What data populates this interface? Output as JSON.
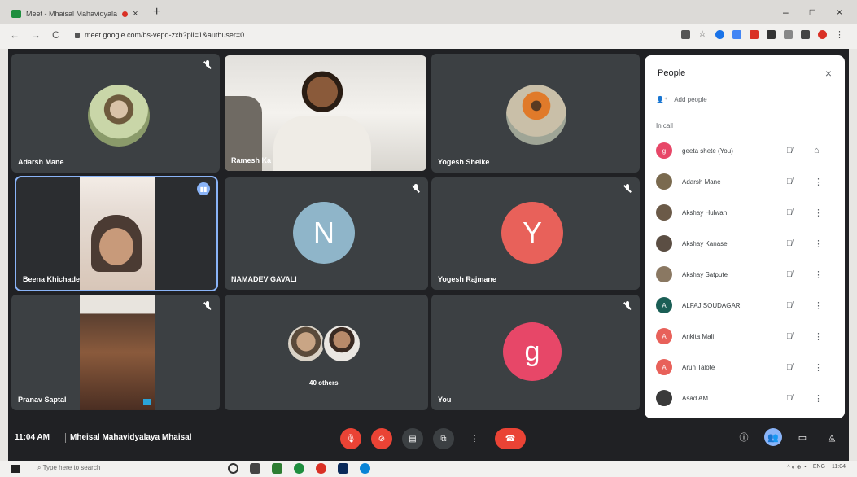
{
  "browser": {
    "tab_title": "Meet - Mhaisal Mahavidyala",
    "tab_close": "×",
    "new_tab": "+",
    "url": "meet.google.com/bs-vepd-zxb?pli=1&authuser=0",
    "win_min": "–",
    "win_max": "□",
    "win_close": "×"
  },
  "tiles": [
    {
      "name": "Adarsh Mane",
      "type": "photo",
      "muted": true
    },
    {
      "name": "Ramesh Ka",
      "type": "video",
      "muted": false
    },
    {
      "name": "Yogesh Shelke",
      "type": "photo",
      "muted": false
    },
    {
      "name": "Beena Khichade",
      "type": "video",
      "muted": false,
      "selected": true
    },
    {
      "name": "NAMADEV GAVALI",
      "type": "letter",
      "letter": "N",
      "color": "#8fb5c9",
      "muted": true
    },
    {
      "name": "Yogesh Rajmane",
      "type": "letter",
      "letter": "Y",
      "color": "#e8615a",
      "muted": true
    },
    {
      "name": "Pranav Saptal",
      "type": "video",
      "muted": true
    },
    {
      "name": "40 others",
      "type": "group",
      "muted": false
    },
    {
      "name": "You",
      "type": "letter",
      "letter": "g",
      "color": "#e74768",
      "muted": true
    }
  ],
  "bottom_bar": {
    "time": "11:04 AM",
    "room": "Mheisal Mahavidyalaya Mhaisal"
  },
  "people_panel": {
    "title": "People",
    "close": "×",
    "add_people": "Add people",
    "in_call": "In call",
    "participants": [
      {
        "name": "geeta shete (You)",
        "initial": "g",
        "color": "#e74768",
        "pin": true
      },
      {
        "name": "Adarsh Mane",
        "initial": "",
        "color": "#7a6a4f",
        "pin": false
      },
      {
        "name": "Akshay Hulwan",
        "initial": "",
        "color": "#6b5a48",
        "pin": false
      },
      {
        "name": "Akshay Kanase",
        "initial": "",
        "color": "#5b4e43",
        "pin": false
      },
      {
        "name": "Akshay Satpute",
        "initial": "",
        "color": "#8a7862",
        "pin": false
      },
      {
        "name": "ALFAJ SOUDAGAR",
        "initial": "A",
        "color": "#1a5e55",
        "pin": false
      },
      {
        "name": "Ankita Mali",
        "initial": "A",
        "color": "#e8615a",
        "pin": false
      },
      {
        "name": "Arun Talote",
        "initial": "A",
        "color": "#e8615a",
        "pin": false
      },
      {
        "name": "Asad AM",
        "initial": "",
        "color": "#3a3a3a",
        "pin": false
      }
    ]
  },
  "taskbar": {
    "search_placeholder": "Type here to search",
    "lang": "ENG",
    "clock": "11:04"
  },
  "colors": {
    "meet_bg": "#202124",
    "tile_bg": "#3c4043",
    "end_call": "#ea4335",
    "accent": "#8ab4f8"
  }
}
